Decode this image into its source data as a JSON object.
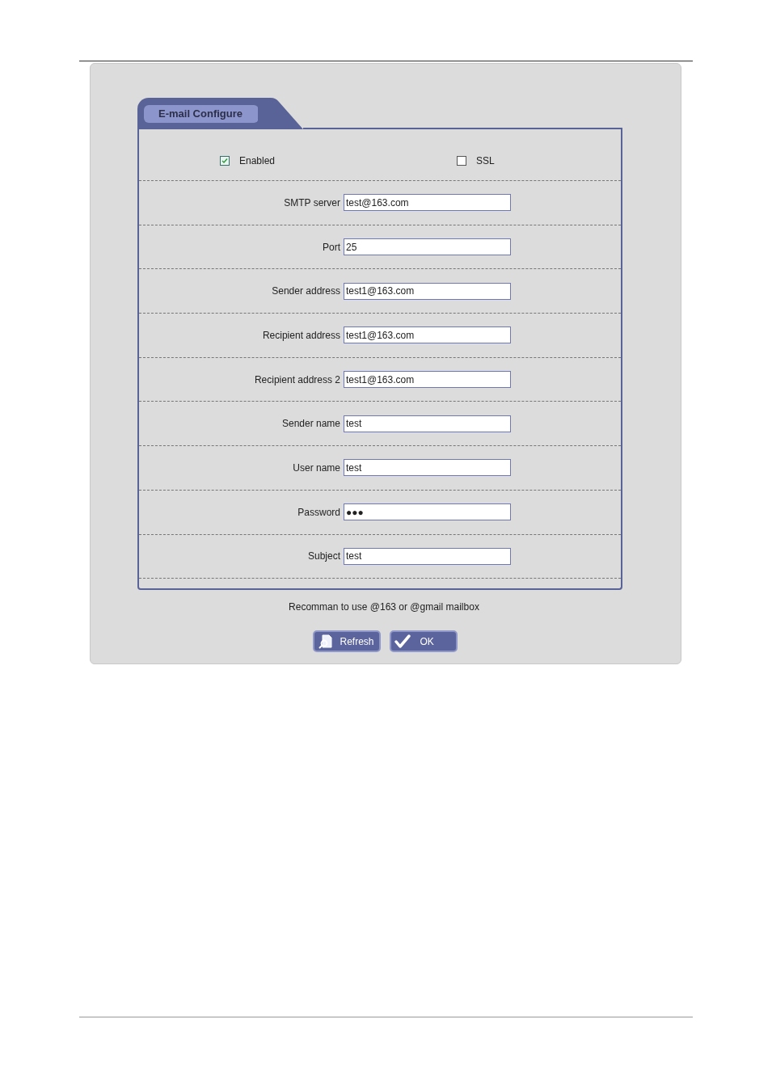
{
  "tab": {
    "label": "E-mail Configure",
    "selected": true
  },
  "options": [
    {
      "label": "Enabled",
      "checked": true
    },
    {
      "label": "SSL",
      "checked": false
    }
  ],
  "fields": [
    {
      "label": "SMTP server",
      "value": "test@163.com"
    },
    {
      "label": "Port",
      "value": "25"
    },
    {
      "label": "Sender address",
      "value": "test1@163.com"
    },
    {
      "label": "Recipient address",
      "value": "test1@163.com"
    },
    {
      "label": "Recipient address 2",
      "value": "test1@163.com"
    },
    {
      "label": "Sender name",
      "value": "test"
    },
    {
      "label": "User name",
      "value": "test"
    },
    {
      "label": "Password",
      "value": "●●●"
    },
    {
      "label": "Subject",
      "value": "test"
    }
  ],
  "hint": "Recomman to use @163 or @gmail mailbox",
  "buttons": [
    {
      "label": "Refresh",
      "kind": "refresh"
    },
    {
      "label": "OK",
      "kind": "ok"
    }
  ]
}
